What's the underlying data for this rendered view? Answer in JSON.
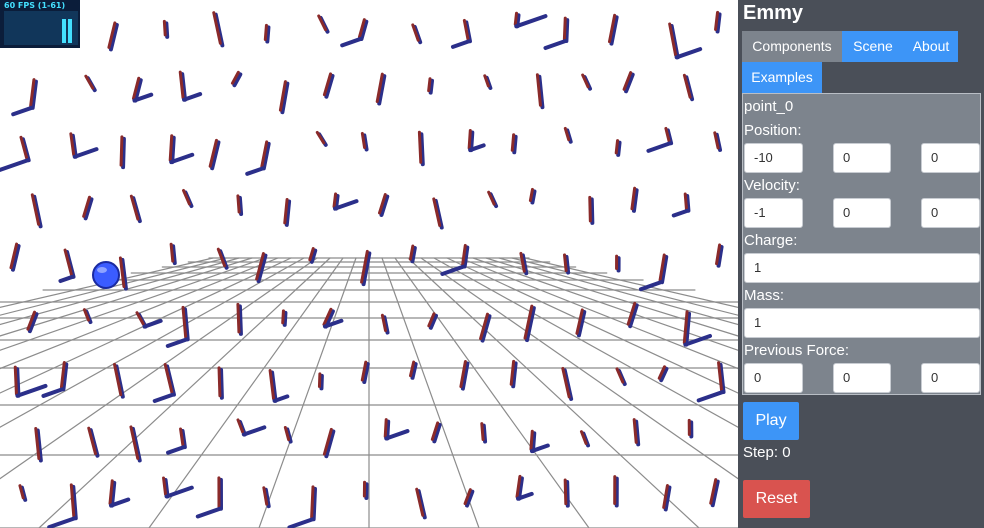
{
  "fps_monitor": {
    "text": "60 FPS (1-61)"
  },
  "app": {
    "title": "Emmy"
  },
  "tabs": [
    {
      "label": "Components",
      "active": true
    },
    {
      "label": "Scene",
      "active": false
    },
    {
      "label": "About",
      "active": false
    },
    {
      "label": "Examples",
      "active": false
    }
  ],
  "component": {
    "name": "point_0",
    "position": {
      "label": "Position:",
      "x": "-10",
      "y": "0",
      "z": "0"
    },
    "velocity": {
      "label": "Velocity:",
      "x": "-1",
      "y": "0",
      "z": "0"
    },
    "charge": {
      "label": "Charge:",
      "value": "1"
    },
    "mass": {
      "label": "Mass:",
      "value": "1"
    },
    "previous_force": {
      "label": "Previous Force:",
      "x": "0",
      "y": "0",
      "z": "0"
    }
  },
  "controls": {
    "play_label": "Play",
    "step_text": "Step: 0",
    "reset_label": "Reset"
  },
  "colors": {
    "tab_blue": "#3d95f7",
    "tab_active": "#7d848d",
    "panel_bg": "#4a4f58",
    "reset_red": "#d9534f",
    "sphere": "#3b5cff",
    "arrow_red": "#8a2a2a",
    "arrow_blue": "#2b2f8a",
    "grid": "#8c8c8c"
  }
}
